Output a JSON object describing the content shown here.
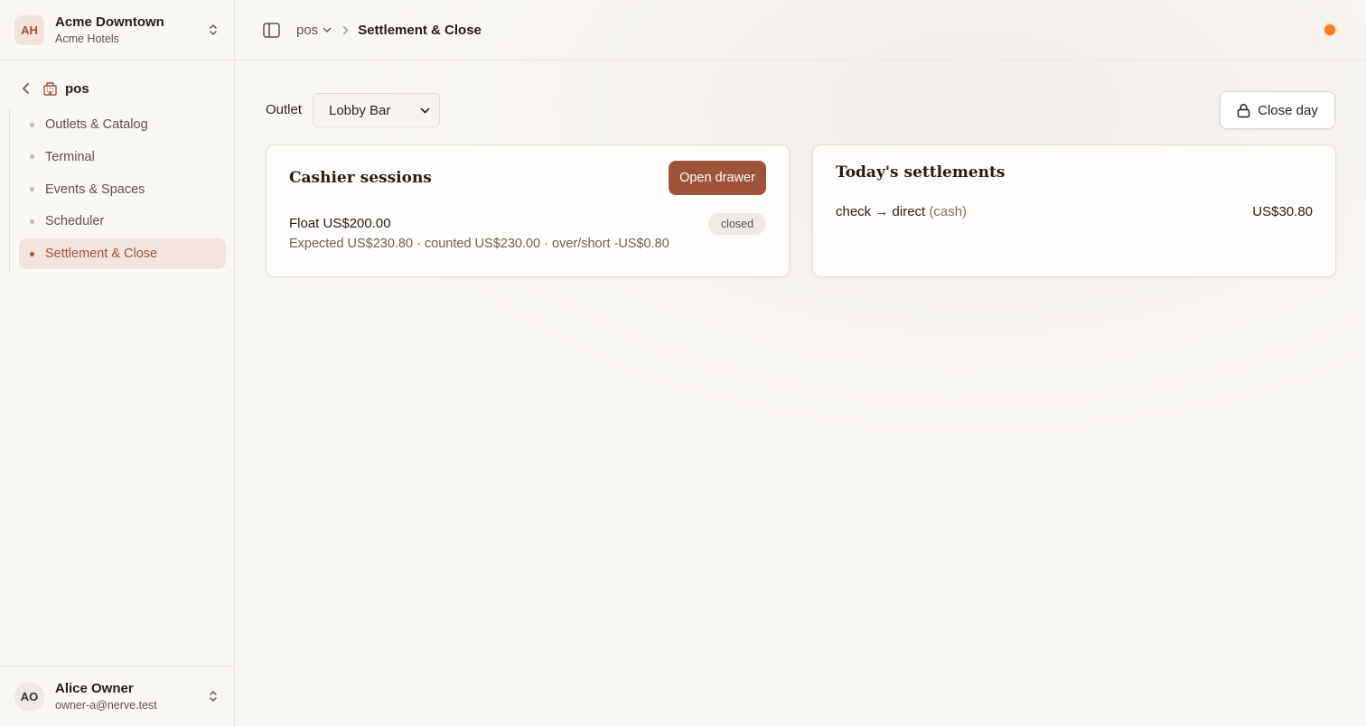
{
  "workspace": {
    "initials": "AH",
    "name": "Acme Downtown",
    "org": "Acme Hotels"
  },
  "module": {
    "label": "pos"
  },
  "nav": {
    "items": [
      {
        "label": "Outlets & Catalog"
      },
      {
        "label": "Terminal"
      },
      {
        "label": "Events & Spaces"
      },
      {
        "label": "Scheduler"
      },
      {
        "label": "Settlement & Close",
        "active": true
      }
    ]
  },
  "user": {
    "initials": "AO",
    "name": "Alice Owner",
    "email": "owner-a@nerve.test"
  },
  "breadcrumb": {
    "module": "pos",
    "current": "Settlement & Close"
  },
  "toolbar": {
    "outlet_label": "Outlet",
    "outlet_selected": "Lobby Bar",
    "close_day_label": "Close day"
  },
  "cashier": {
    "title": "Cashier sessions",
    "open_drawer_label": "Open drawer",
    "session": {
      "float": "Float US$200.00",
      "details": "Expected US$230.80 · counted US$230.00 · over/short -US$0.80",
      "status": "closed"
    }
  },
  "settlements": {
    "title": "Today's settlements",
    "rows": [
      {
        "route": "check → direct",
        "method": "(cash)",
        "amount": "US$30.80"
      }
    ]
  },
  "colors": {
    "accent": "#a0523a",
    "status_dot": "#f47c20"
  }
}
